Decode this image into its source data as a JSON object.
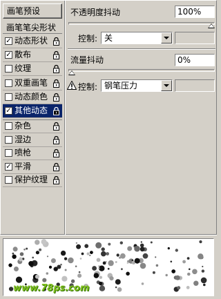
{
  "left_panel": {
    "preset_label": "画笔预设",
    "brush_tip_label": "画笔笔尖形状",
    "options": [
      {
        "label": "动态形状",
        "checked": true,
        "active": false
      },
      {
        "label": "散布",
        "checked": true,
        "active": false
      },
      {
        "label": "纹理",
        "checked": false,
        "active": false
      },
      {
        "label": "双重画笔",
        "checked": false,
        "active": false
      },
      {
        "label": "动态颜色",
        "checked": false,
        "active": false
      },
      {
        "label": "其他动态",
        "checked": true,
        "active": true
      },
      {
        "label": "杂色",
        "checked": false,
        "active": false
      },
      {
        "label": "湿边",
        "checked": false,
        "active": false
      },
      {
        "label": "喷枪",
        "checked": false,
        "active": false
      },
      {
        "label": "平滑",
        "checked": true,
        "active": false
      },
      {
        "label": "保护纹理",
        "checked": false,
        "active": false
      }
    ]
  },
  "opacity_jitter": {
    "label": "不透明度抖动",
    "value": "100%",
    "slider_fraction": 1.0,
    "control_label": "控制:",
    "control_value": "关"
  },
  "flow_jitter": {
    "label": "流量抖动",
    "value": "0%",
    "slider_fraction": 0.0,
    "control_label": "控制:",
    "control_value": "钢笔压力",
    "warning_icon": "warning-icon"
  },
  "preview": {
    "watermark": "www.78ps.com"
  }
}
